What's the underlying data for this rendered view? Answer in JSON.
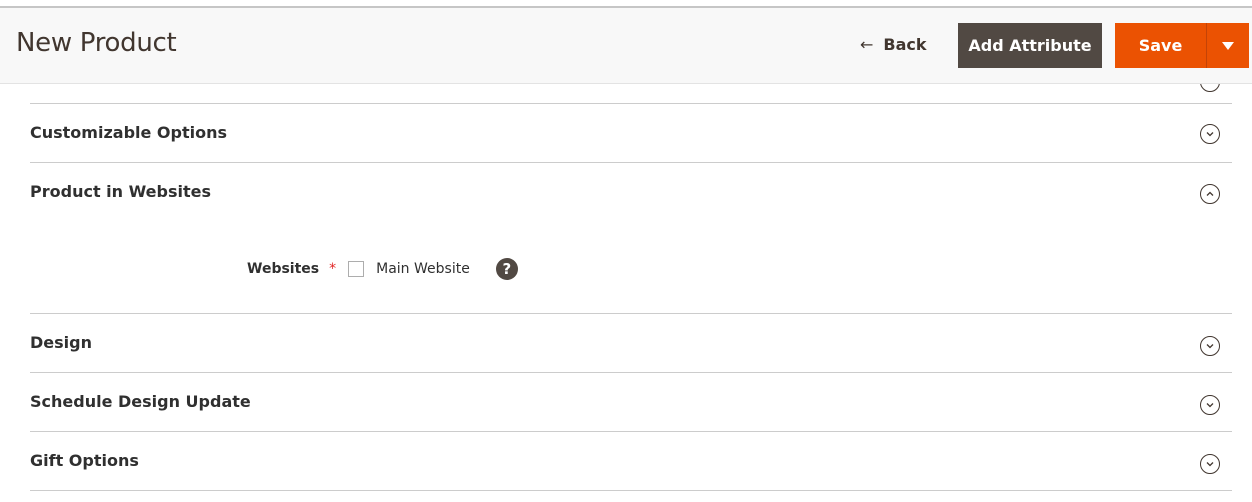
{
  "header": {
    "title": "New Product",
    "back_label": "Back",
    "back_icon": "arrow-left-icon",
    "add_attribute_label": "Add Attribute",
    "save_label": "Save",
    "save_dropdown_icon": "triangle-down-icon"
  },
  "colors": {
    "save": "#eb5202",
    "add_attribute": "#514943",
    "required": "#e22626"
  },
  "sections": [
    {
      "label": "Customizable Options",
      "state": "collapsed"
    },
    {
      "label": "Product in Websites",
      "state": "expanded"
    },
    {
      "label": "Design",
      "state": "collapsed"
    },
    {
      "label": "Schedule Design Update",
      "state": "collapsed"
    },
    {
      "label": "Gift Options",
      "state": "collapsed"
    }
  ],
  "websites_field": {
    "label": "Websites",
    "required_mark": "*",
    "options": [
      {
        "label": "Main Website",
        "checked": false
      }
    ],
    "help_glyph": "?"
  }
}
